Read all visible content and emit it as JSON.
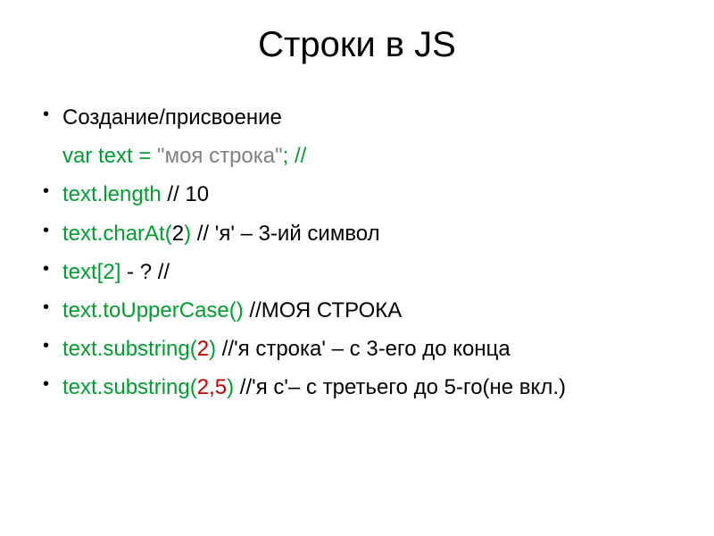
{
  "title": "Строки в JS",
  "items": [
    {
      "bullet": true,
      "parts": [
        {
          "text": "Создание/присвоение",
          "color": "c0"
        }
      ]
    },
    {
      "bullet": false,
      "parts": [
        {
          "text": "var text = ",
          "color": "c-green"
        },
        {
          "text": "\"моя строка\"",
          "color": "c-gray"
        },
        {
          "text": "; //",
          "color": "c-green"
        }
      ]
    },
    {
      "bullet": true,
      "parts": [
        {
          "text": "text.length",
          "color": "c-green"
        },
        {
          "text": " // 10",
          "color": "c0"
        }
      ]
    },
    {
      "bullet": true,
      "parts": [
        {
          "text": "text.charAt(",
          "color": "c-green"
        },
        {
          "text": "2",
          "color": "c0"
        },
        {
          "text": ")",
          "color": "c-green"
        },
        {
          "text": " // 'я' – 3-ий символ",
          "color": "c0"
        }
      ]
    },
    {
      "bullet": true,
      "parts": [
        {
          "text": "text[2]",
          "color": "c-green"
        },
        {
          "text": " - ? //",
          "color": "c0"
        }
      ]
    },
    {
      "bullet": true,
      "parts": [
        {
          "text": "text.toUpperCase()",
          "color": "c-green"
        },
        {
          "text": " //МОЯ СТРОКА",
          "color": "c0"
        }
      ]
    },
    {
      "bullet": true,
      "parts": [
        {
          "text": "text.substring(",
          "color": "c-green"
        },
        {
          "text": "2",
          "color": "c-red"
        },
        {
          "text": ")",
          "color": "c-green"
        },
        {
          "text": " //'я строка'  – с 3-его  до конца",
          "color": "c0"
        }
      ]
    },
    {
      "bullet": true,
      "parts": [
        {
          "text": "text.substring(",
          "color": "c-green"
        },
        {
          "text": "2,5",
          "color": "c-red"
        },
        {
          "text": ")",
          "color": "c-green"
        },
        {
          "text": " //'я с'– с третьего до 5-го(не вкл.)",
          "color": "c0"
        }
      ]
    }
  ]
}
